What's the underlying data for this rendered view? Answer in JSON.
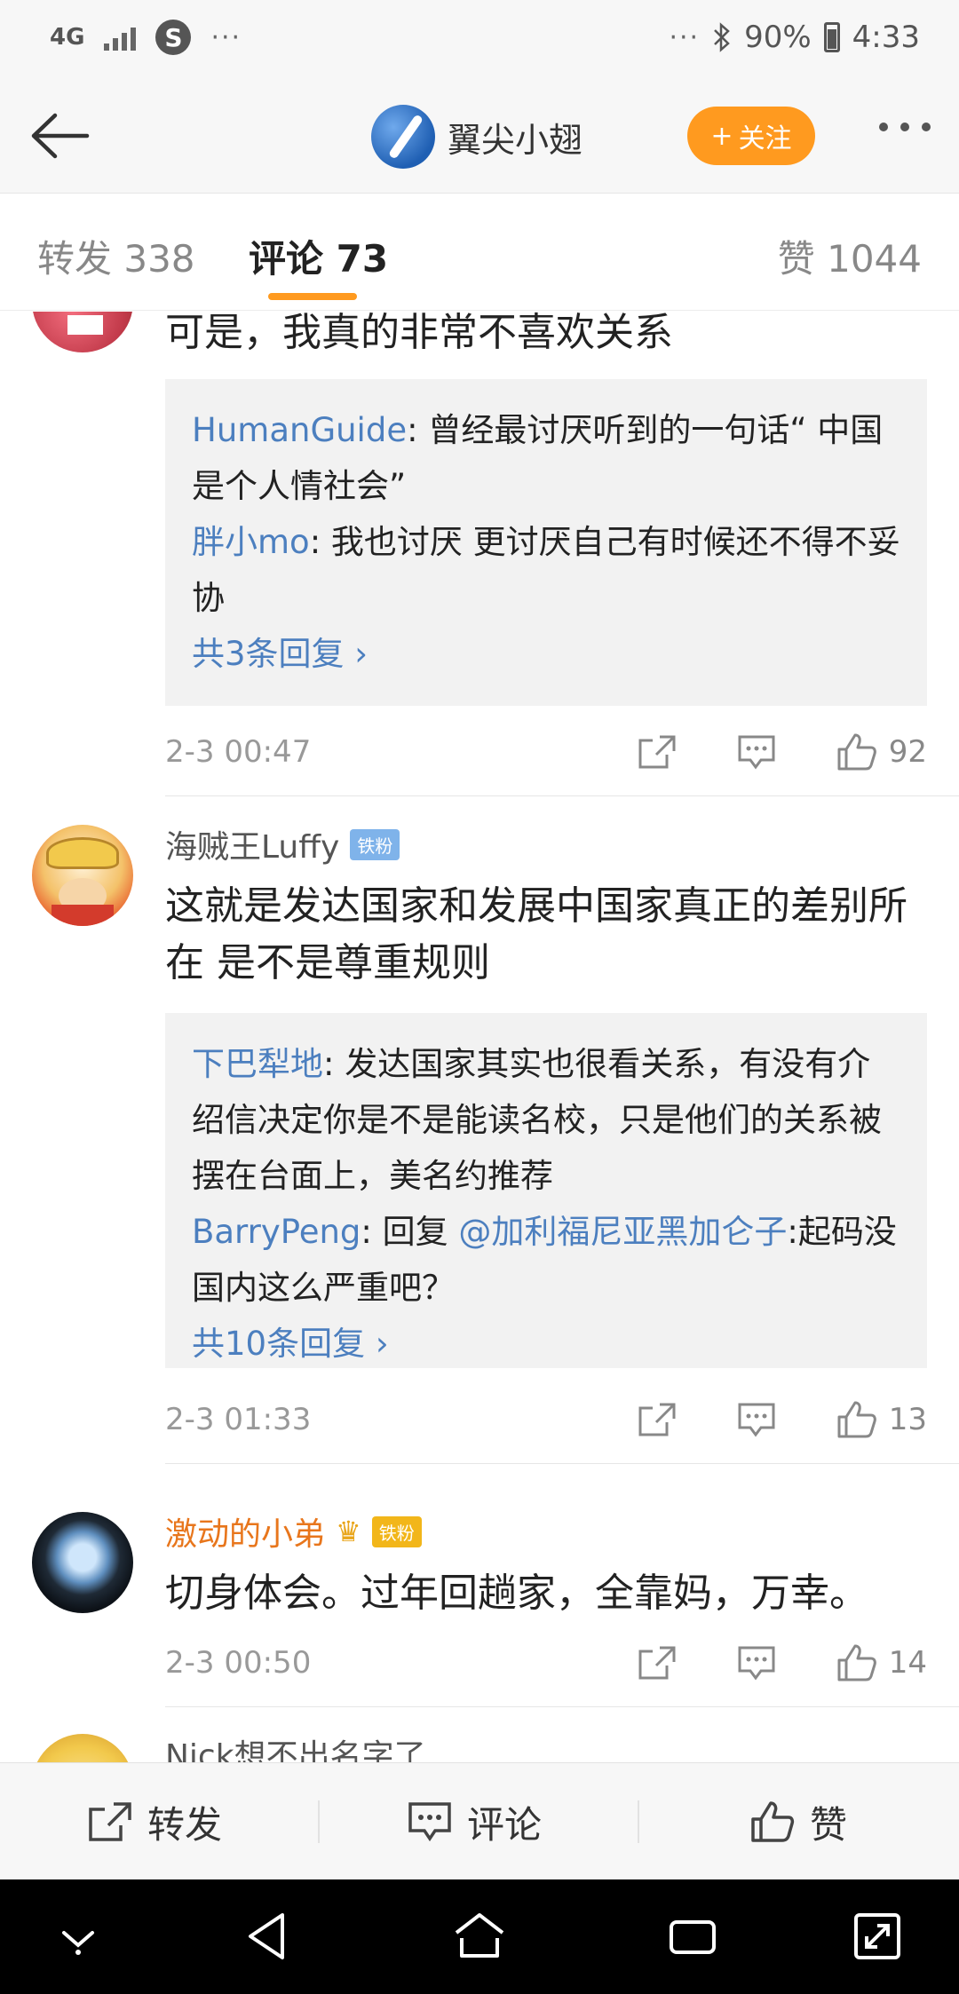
{
  "status_bar": {
    "network": "4G",
    "dots_left": "···",
    "dots_right": "···",
    "battery": "90%",
    "time": "4:33",
    "app_badge": "S"
  },
  "header": {
    "title": "翼尖小翅",
    "follow_label": "关注",
    "follow_prefix": "+"
  },
  "tabs": {
    "repost": "转发 338",
    "comment": "评论 73",
    "like": "赞 1044"
  },
  "comments": [
    {
      "text": "可是，我真的非常不喜欢关系",
      "replies": [
        {
          "name": "HumanGuide",
          "text": ": 曾经最讨厌听到的一句话“ 中国是个人情社会”"
        },
        {
          "name": "胖小mo",
          "text": ": 我也讨厌 更讨厌自己有时候还不得不妥协"
        }
      ],
      "more": "共3条回复 ›",
      "time": "2-3 00:47",
      "likes": "92"
    },
    {
      "author": "海贼王Luffy",
      "badge": "铁粉",
      "text": "这就是发达国家和发展中国家真正的差别所在 是不是尊重规则",
      "replies": [
        {
          "name": "下巴犁地",
          "text": ": 发达国家其实也很看关系，有没有介绍信决定你是不是能读名校，只是他们的关系被摆在台面上，美名约推荐"
        },
        {
          "name": "BarryPeng",
          "text": ": 回复 ",
          "mention": "@加利福尼亚黑加仑子",
          "after": ":起码没国内这么严重吧？"
        }
      ],
      "more": "共10条回复 ›",
      "time": "2-3 01:33",
      "likes": "13"
    },
    {
      "author": "激动的小弟",
      "badge": "铁粉",
      "text": "切身体会。过年回趟家，全靠妈，万幸。",
      "time": "2-3 00:50",
      "likes": "14"
    },
    {
      "author": "Nick想不出名字了"
    }
  ],
  "bottom_bar": {
    "repost": "转发",
    "comment": "评论",
    "like": "赞"
  },
  "colors": {
    "accent": "#ff9a1f",
    "link": "#4c7fbf",
    "vip_name": "#e8761c"
  }
}
